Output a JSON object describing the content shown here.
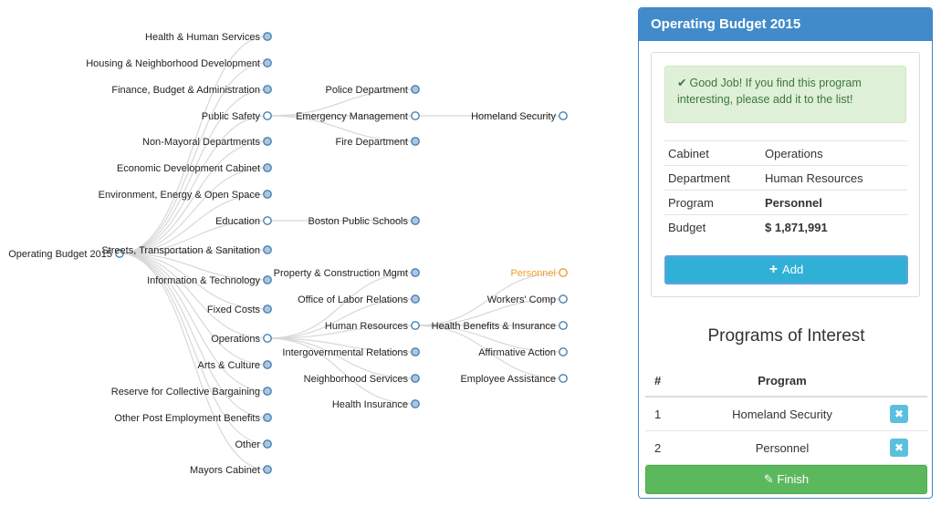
{
  "tree": {
    "root": "Operating Budget 2015",
    "cabinets": [
      "Health & Human Services",
      "Housing & Neighborhood Development",
      "Finance, Budget & Administration",
      "Public Safety",
      "Non-Mayoral Departments",
      "Economic Development Cabinet",
      "Environment, Energy & Open Space",
      "Education",
      "Streets, Transportation & Sanitation",
      "Information & Technology",
      "Fixed Costs",
      "Operations",
      "Arts & Culture",
      "Reserve for Collective Bargaining",
      "Other Post Employment Benefits",
      "Other",
      "Mayors Cabinet"
    ],
    "public_safety_depts": [
      "Police Department",
      "Emergency Management",
      "Fire Department"
    ],
    "emergency_programs": [
      "Homeland Security"
    ],
    "education_depts": [
      "Boston Public Schools"
    ],
    "operations_depts": [
      "Property & Construction Mgmt",
      "Office of Labor Relations",
      "Human Resources",
      "Intergovernmental Relations",
      "Neighborhood Services",
      "Health Insurance"
    ],
    "hr_programs": [
      "Personnel",
      "Workers' Comp",
      "Health Benefits & Insurance",
      "Affirmative Action",
      "Employee Assistance"
    ],
    "highlight": "Personnel"
  },
  "panel": {
    "title": "Operating Budget 2015",
    "alert_icon": "check-icon",
    "alert_text": "Good Job! If you find this program interesting, please add it to the list!",
    "details": [
      {
        "label": "Cabinet",
        "value": "Operations"
      },
      {
        "label": "Department",
        "value": "Human Resources"
      },
      {
        "label": "Program",
        "value": "Personnel"
      },
      {
        "label": "Budget",
        "value": "$ 1,871,991"
      }
    ],
    "add_label": "Add",
    "interest_title": "Programs of Interest",
    "interest_headers": [
      "#",
      "Program"
    ],
    "interest": [
      {
        "num": "1",
        "program": "Homeland Security"
      },
      {
        "num": "2",
        "program": "Personnel"
      }
    ],
    "remove_icon": "remove-icon",
    "finish_label": "Finish",
    "finish_icon": "pencil-icon"
  },
  "colors": {
    "header": "#428bca",
    "highlight": "#f0a030",
    "add_button": "#31b0d5",
    "finish_button": "#5cb85c",
    "alert_bg": "#dff0d8"
  }
}
